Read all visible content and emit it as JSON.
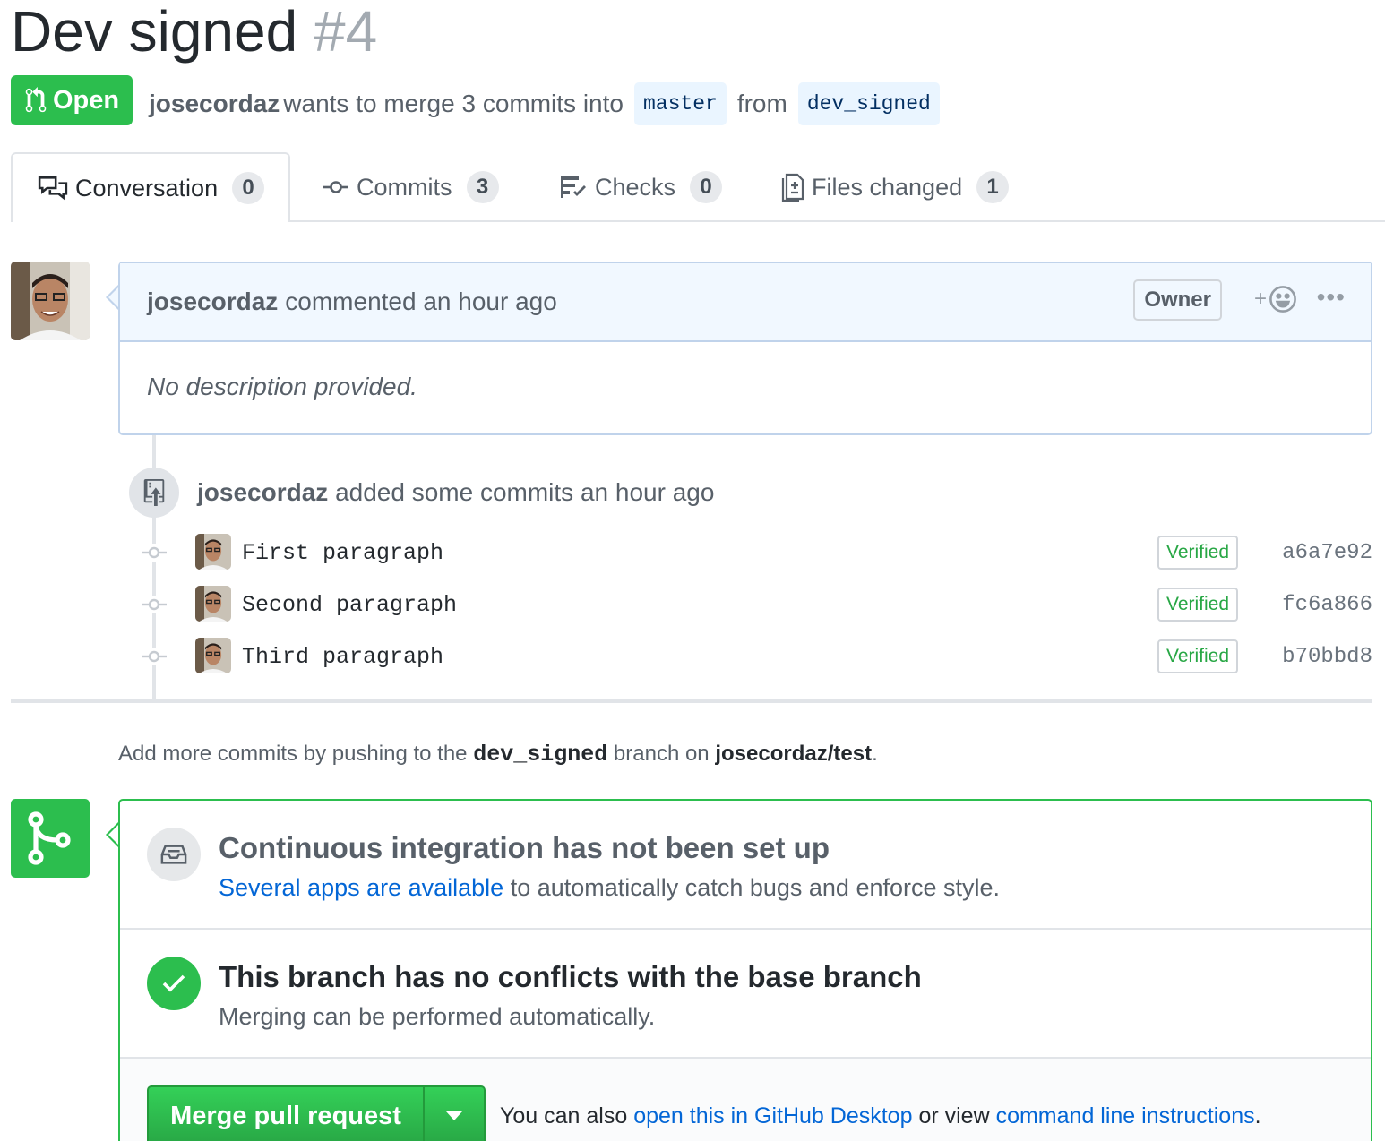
{
  "pr": {
    "title": "Dev signed",
    "number": "#4",
    "state": "Open",
    "author": "josecordaz",
    "merge_text": "wants to merge 3 commits into",
    "base_branch": "master",
    "from_text": "from",
    "head_branch": "dev_signed"
  },
  "tabs": [
    {
      "label": "Conversation",
      "count": "0",
      "icon": "comment-discussion-icon",
      "selected": true
    },
    {
      "label": "Commits",
      "count": "3",
      "icon": "commit-icon",
      "selected": false
    },
    {
      "label": "Checks",
      "count": "0",
      "icon": "checklist-icon",
      "selected": false
    },
    {
      "label": "Files changed",
      "count": "1",
      "icon": "diff-icon",
      "selected": false
    }
  ],
  "comment": {
    "author": "josecordaz",
    "action": "commented an hour ago",
    "badge": "Owner",
    "reaction_plus": "+",
    "more": "•••",
    "body": "No description provided."
  },
  "timeline": {
    "author": "josecordaz",
    "event_text": "added some commits an hour ago",
    "commits": [
      {
        "message": "First paragraph",
        "verified": "Verified",
        "sha": "a6a7e92"
      },
      {
        "message": "Second paragraph",
        "verified": "Verified",
        "sha": "fc6a866"
      },
      {
        "message": "Third paragraph",
        "verified": "Verified",
        "sha": "b70bbd8"
      }
    ]
  },
  "push_note": {
    "prefix": "Add more commits by pushing to the",
    "branch": "dev_signed",
    "middle": "branch on",
    "repo": "josecordaz/test",
    "suffix": "."
  },
  "merge": {
    "ci_title": "Continuous integration has not been set up",
    "ci_link": "Several apps are available",
    "ci_rest": "to automatically catch bugs and enforce style.",
    "ok_title": "This branch has no conflicts with the base branch",
    "ok_sub": "Merging can be performed automatically.",
    "button_label": "Merge pull request",
    "note_prefix": "You can also",
    "note_link1": "open this in GitHub Desktop",
    "note_middle": "or view",
    "note_link2": "command line instructions",
    "note_suffix": "."
  },
  "colors": {
    "green": "#2cbe4e",
    "link": "#0366d6",
    "comment_header": "#f1f8ff"
  }
}
